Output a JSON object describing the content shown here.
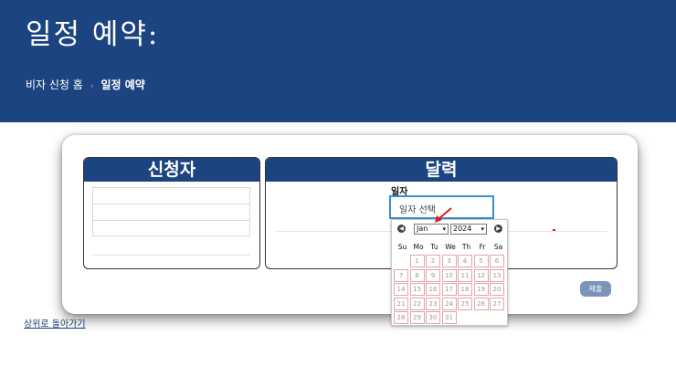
{
  "header": {
    "title": "일정 예약:",
    "breadcrumb": {
      "home": "비자 신청 홈",
      "separator": "›",
      "current": "일정 예약"
    }
  },
  "applicant_panel": {
    "title": "신청자",
    "rows": 3
  },
  "calendar_panel": {
    "title": "달력"
  },
  "date_field": {
    "label": "일자",
    "placeholder": "일자 선택"
  },
  "datepicker": {
    "month": "Jan",
    "year": "2024",
    "weekdays": [
      "Su",
      "Mo",
      "Tu",
      "We",
      "Th",
      "Fr",
      "Sa"
    ],
    "days": [
      "1",
      "2",
      "3",
      "4",
      "5",
      "6",
      "7",
      "8",
      "9",
      "10",
      "11",
      "12",
      "13",
      "14",
      "15",
      "16",
      "17",
      "18",
      "19",
      "20",
      "21",
      "22",
      "23",
      "24",
      "25",
      "26",
      "27",
      "28",
      "29",
      "30",
      "31"
    ],
    "first_weekday_index": 1
  },
  "actions": {
    "submit_label": "제출",
    "back_label": "상위로 돌아가기"
  },
  "colors": {
    "brand_blue": "#1c4480",
    "focus_blue": "#3a8fd8",
    "day_border": "#e6a4a4",
    "annotation_red": "#d42020"
  }
}
